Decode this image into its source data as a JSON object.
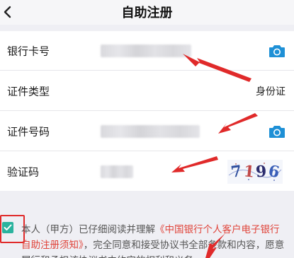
{
  "header": {
    "title": "自助注册",
    "back_icon": "chevron-left-icon"
  },
  "form": {
    "rows": [
      {
        "label": "银行卡号",
        "value": "",
        "action_icon": "camera-icon"
      },
      {
        "label": "证件类型",
        "value": "身份证"
      },
      {
        "label": "证件号码",
        "value": "",
        "action_icon": "camera-icon"
      },
      {
        "label": "验证码",
        "value": "",
        "captcha": [
          "7",
          "1",
          "9",
          "6"
        ]
      }
    ]
  },
  "agreement": {
    "checked": true,
    "text_prefix": "本人（甲方）已仔细阅读并理解",
    "link_text": "《中国银行个人客户电子银行自助注册须知》",
    "text_suffix": "，完全同意和接受协议书全部条款和内容，愿意履行和承担该协议书中约定的权利和义务。"
  },
  "colors": {
    "accent": "#2bb39e",
    "camera": "#1e90d6",
    "link": "#e0443a",
    "annotation": "#e02a2a"
  }
}
